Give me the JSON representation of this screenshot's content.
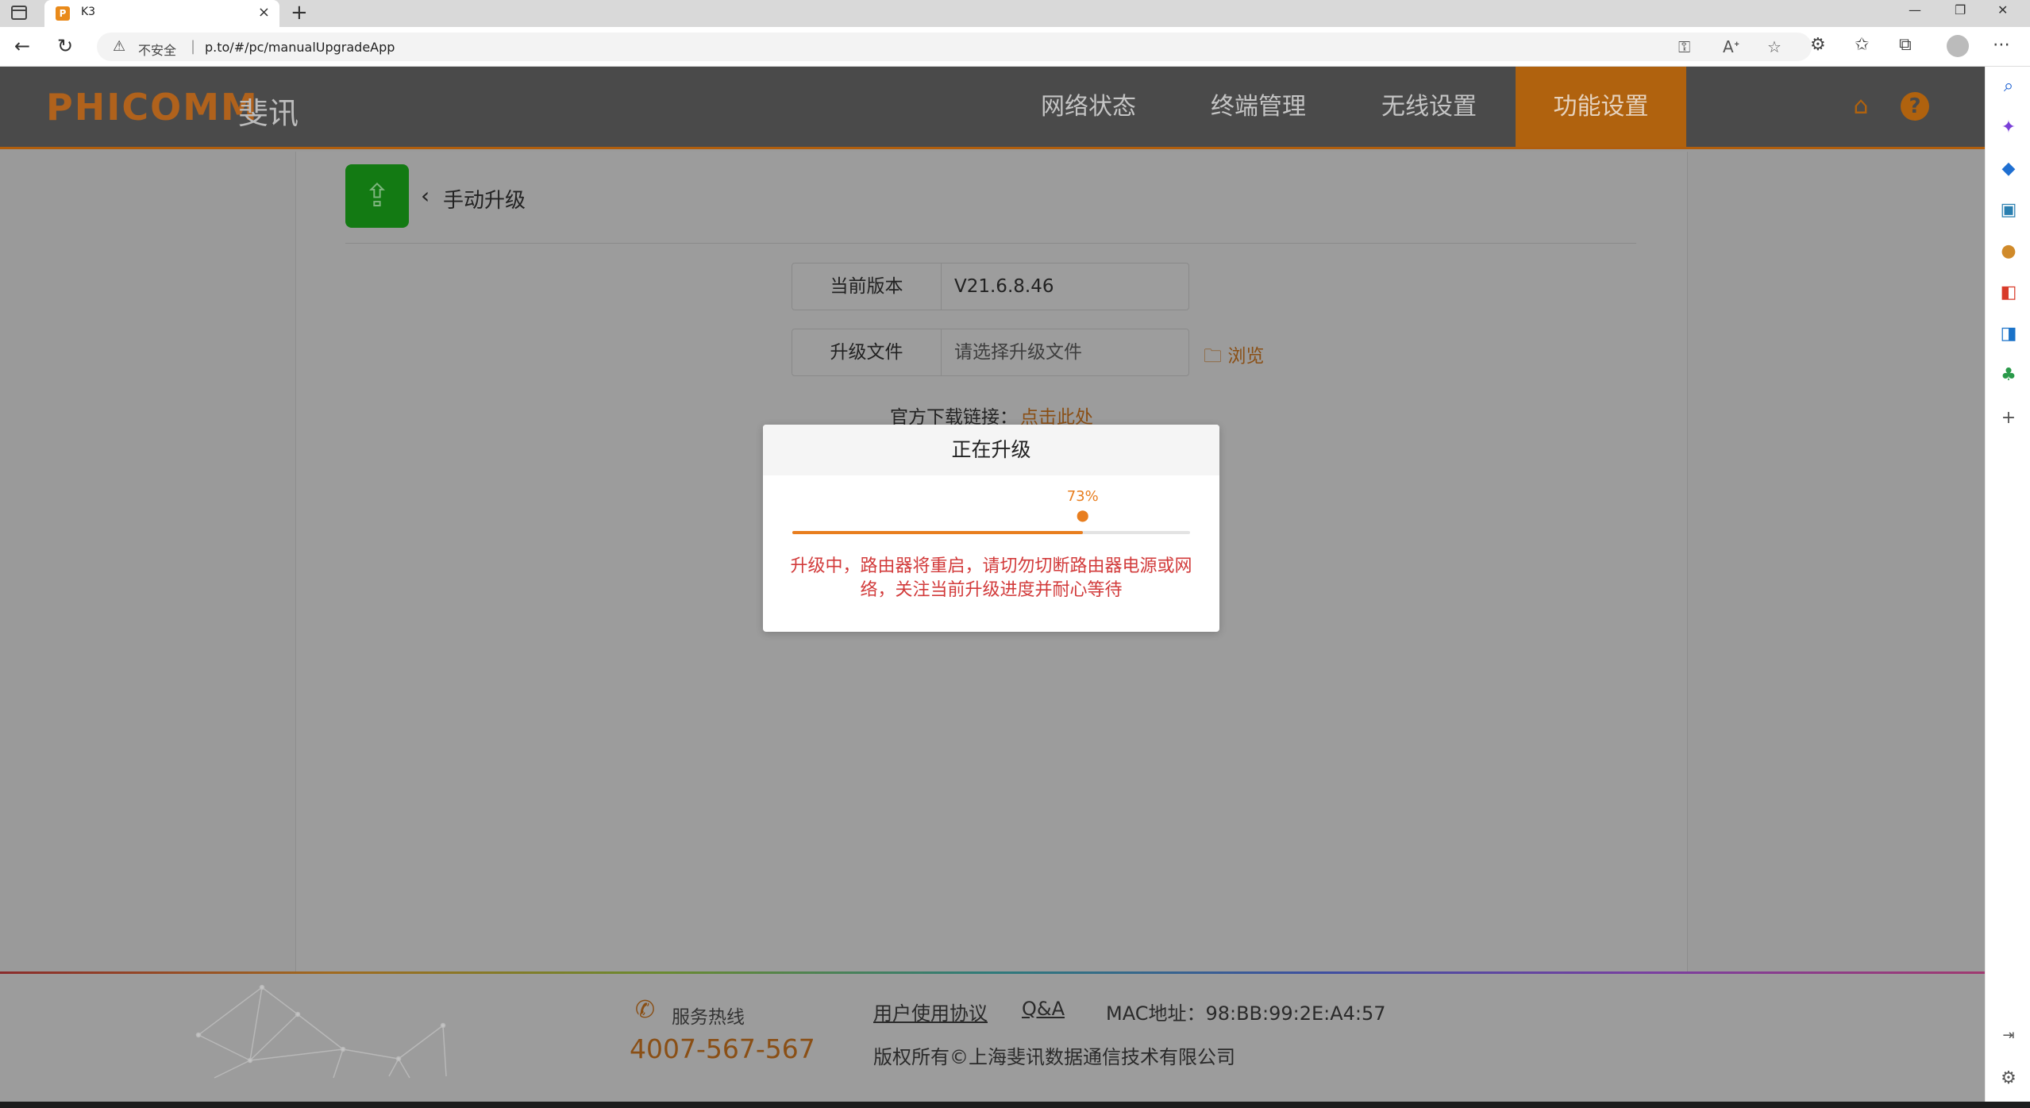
{
  "browser": {
    "tab_favicon": "P",
    "tab_title": "K3",
    "close_glyph": "×",
    "newtab_glyph": "+",
    "insecure_label": "不安全",
    "url": "p.to/#/pc/manualUpgradeApp"
  },
  "icons": {
    "back": "←",
    "reload": "↻",
    "warning": "⚠",
    "star": "☆",
    "more": "⋯",
    "minimize": "—",
    "restore": "❐",
    "window_close": "✕"
  },
  "app": {
    "logo_text": "PHICOMM",
    "logo_cn": "斐讯",
    "nav": [
      "网络状态",
      "终端管理",
      "无线设置",
      "功能设置"
    ],
    "active_nav_index": 3,
    "accent_color": "#e87e1f",
    "page_title": "手动升级",
    "back_glyph": "‹",
    "current_version_label": "当前版本",
    "current_version_value": "V21.6.8.46",
    "upgrade_file_label": "升级文件",
    "upgrade_file_placeholder": "请选择升级文件",
    "browse_label": "浏览",
    "download_label": "官方下载链接：",
    "download_link": "点击此处"
  },
  "footer": {
    "hotline_label": "服务热线",
    "hotline_number": "4007-567-567",
    "user_agreement": "用户使用协议",
    "qa": "Q&A",
    "mac": "MAC地址：98:BB:99:2E:A4:57",
    "copyright": "版权所有©上海斐讯数据通信技术有限公司"
  },
  "modal": {
    "title": "正在升级",
    "progress": 73,
    "progress_label": "73%",
    "message": "升级中，路由器将重启，请切勿切断路由器电源或网络，关注当前升级进度并耐心等待"
  }
}
